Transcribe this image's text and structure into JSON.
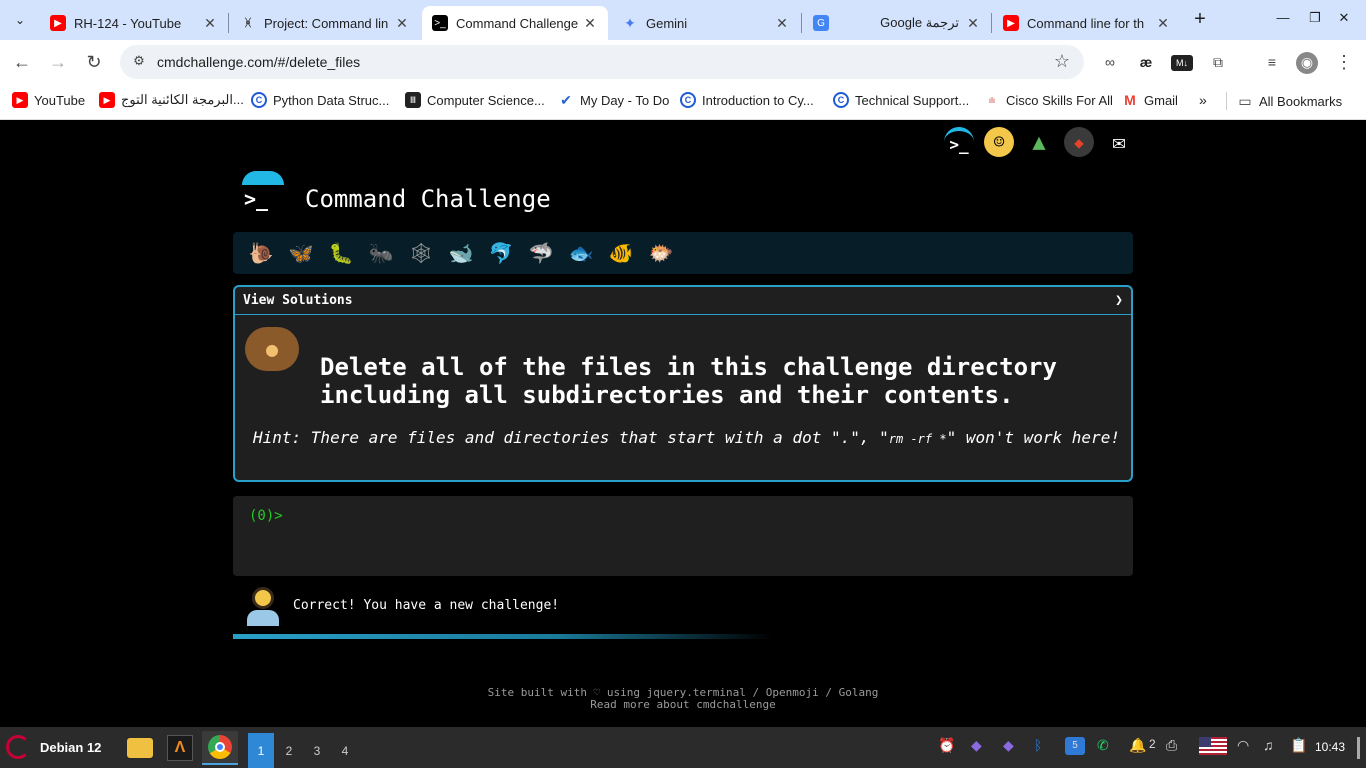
{
  "browser": {
    "tabs": [
      {
        "title": "RH-124 - YouTube",
        "favicon": "youtube-icon"
      },
      {
        "title": "Project: Command lin",
        "favicon": "odin-icon"
      },
      {
        "title": "Command Challenge",
        "favicon": "terminal-icon"
      },
      {
        "title": "Gemini",
        "favicon": "gemini-icon"
      },
      {
        "title": "Google ترجمة",
        "favicon": "translate-icon"
      },
      {
        "title": "Command line for th",
        "favicon": "youtube-icon"
      }
    ],
    "url": "cmdchallenge.com/#/delete_files",
    "bookmarks": [
      {
        "label": "YouTube",
        "icon": "youtube-icon"
      },
      {
        "label": "البرمجة الكائنية التوج...",
        "icon": "youtube-icon"
      },
      {
        "label": "Python Data Struc...",
        "icon": "coursera-icon"
      },
      {
        "label": "Computer Science...",
        "icon": "columns-icon"
      },
      {
        "label": "My Day - To Do",
        "icon": "check-icon"
      },
      {
        "label": "Introduction to Cy...",
        "icon": "coursera-icon"
      },
      {
        "label": "Technical Support...",
        "icon": "coursera-icon"
      },
      {
        "label": "Cisco Skills For All",
        "icon": "cisco-icon"
      },
      {
        "label": "Gmail",
        "icon": "gmail-icon"
      }
    ],
    "all_bookmarks": "All Bookmarks"
  },
  "page": {
    "title": "Command Challenge",
    "logo_prompt": ">_",
    "solutions_label": "View Solutions",
    "solutions_chevron": "❯",
    "challenge_line1": "Delete all of the files in this challenge directory",
    "challenge_line2": "including all subdirectories and their contents.",
    "hint_before": "Hint: There are files and directories that start with a dot \".\", \"",
    "hint_code": "rm -rf *",
    "hint_after": "\" won't work here!",
    "prompt": "(0)>",
    "status_message": "Correct! You have a new challenge!",
    "progress_fraction": 0.6,
    "footer_line1": "Site built with ♡ using jquery.terminal / Openmoji / Golang",
    "footer_line2": "Read more about cmdchallenge",
    "animals": [
      "snail-icon",
      "butterfly-icon",
      "caterpillar-icon",
      "ant-icon",
      "spider-web-icon",
      "whale-icon",
      "dolphin-icon",
      "shark-icon",
      "fish-icon",
      "tropical-fish-icon",
      "pufferfish-icon"
    ]
  },
  "taskbar": {
    "distro": "Debian 12",
    "workspaces": [
      "1",
      "2",
      "3",
      "4"
    ],
    "notifications_count": "2",
    "clock": "10:43"
  },
  "colors": {
    "accent": "#2aa0c8",
    "terminal_green": "#22cc22",
    "tabstrip": "#d3e3fd"
  }
}
